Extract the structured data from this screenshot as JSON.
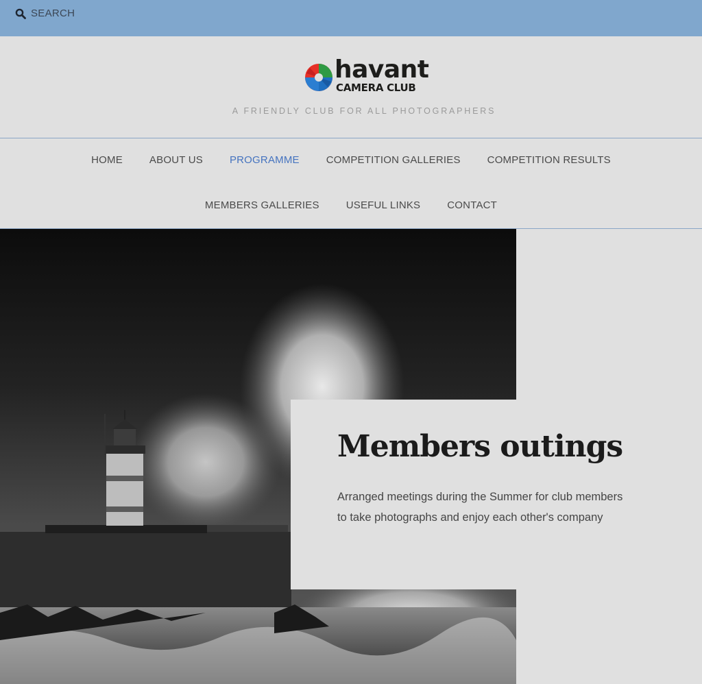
{
  "topbar": {
    "search_icon": "search-icon",
    "search_label": "SEARCH"
  },
  "logo": {
    "word": "havant",
    "sub": "CAMERA CLUB",
    "colors": [
      "#e63027",
      "#2f9a44",
      "#1e6fc0"
    ]
  },
  "tagline": "A FRIENDLY CLUB FOR ALL PHOTOGRAPHERS",
  "nav": {
    "items": [
      {
        "label": "HOME"
      },
      {
        "label": "ABOUT US"
      },
      {
        "label": "PROGRAMME"
      },
      {
        "label": "COMPETITION GALLERIES"
      },
      {
        "label": "COMPETITION RESULTS"
      },
      {
        "label": "MEMBERS GALLERIES"
      },
      {
        "label": "USEFUL LINKS"
      },
      {
        "label": "CONTACT"
      }
    ],
    "active": "PROGRAMME"
  },
  "feature": {
    "title": "Members outings",
    "body": "Arranged meetings during the Summer for club members to take photographs and enjoy each other's company"
  },
  "colors": {
    "topbar": "#80a7cd",
    "page": "#e0e0e0",
    "nav_active": "#4573bf"
  }
}
